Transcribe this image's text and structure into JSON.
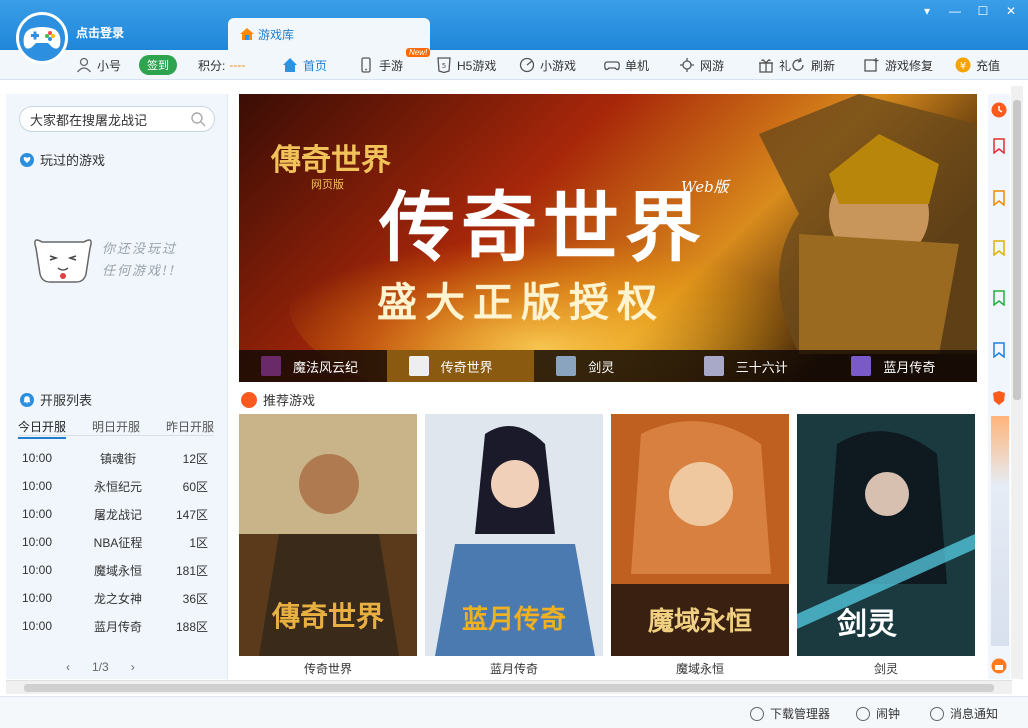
{
  "header": {
    "login_text": "点击登录",
    "tab_label": "游戏库",
    "window_controls": [
      "▾",
      "—",
      "☐",
      "✕"
    ]
  },
  "toolbar": {
    "nickname": "小号",
    "signin": "签到",
    "score_label": "积分:",
    "score_value": "----",
    "nav": [
      {
        "label": "首页",
        "icon": "home-icon"
      },
      {
        "label": "手游",
        "icon": "phone-icon",
        "badge": "New!"
      },
      {
        "label": "H5游戏",
        "icon": "h5-icon"
      },
      {
        "label": "小游戏",
        "icon": "mini-game-icon"
      },
      {
        "label": "单机",
        "icon": "gamepad-icon"
      },
      {
        "label": "网游",
        "icon": "network-icon"
      },
      {
        "label": "礼",
        "icon": "gift-icon"
      }
    ],
    "actions": [
      {
        "label": "刷新",
        "icon": "refresh-icon"
      },
      {
        "label": "游戏修复",
        "icon": "repair-icon"
      },
      {
        "label": "充值",
        "icon": "yen-icon"
      }
    ]
  },
  "sidebar": {
    "search_value": "大家都在搜屠龙战记",
    "played_title": "玩过的游戏",
    "empty_line1": "你还没玩过",
    "empty_line2": "任何游戏!!",
    "server_title": "开服列表",
    "server_tabs": [
      "今日开服",
      "明日开服",
      "昨日开服"
    ],
    "servers": [
      {
        "time": "10:00",
        "name": "镇魂街",
        "zone": "12区"
      },
      {
        "time": "10:00",
        "name": "永恒纪元",
        "zone": "60区"
      },
      {
        "time": "10:00",
        "name": "屠龙战记",
        "zone": "147区"
      },
      {
        "time": "10:00",
        "name": "NBA征程",
        "zone": "1区"
      },
      {
        "time": "10:00",
        "name": "魔域永恒",
        "zone": "181区"
      },
      {
        "time": "10:00",
        "name": "龙之女神",
        "zone": "36区"
      },
      {
        "time": "10:00",
        "name": "蓝月传奇",
        "zone": "188区"
      }
    ],
    "pager": {
      "prev": "‹",
      "page": "1/3",
      "next": "›"
    }
  },
  "banner": {
    "title": "传奇世界",
    "tag": "Web版",
    "subtitle": "盛大正版授权",
    "logo_line1": "傳奇世界",
    "logo_line2": "网页版",
    "thumbs": [
      "魔法风云纪",
      "传奇世界",
      "剑灵",
      "三十六计",
      "蓝月传奇"
    ],
    "active_thumb": 1
  },
  "recommended": {
    "title": "推荐游戏",
    "cards": [
      {
        "name": "传奇世界",
        "art": "傳奇世界"
      },
      {
        "name": "蓝月传奇",
        "art": "蓝月传奇"
      },
      {
        "name": "魔域永恒",
        "art": "魔域永恒"
      },
      {
        "name": "剑灵",
        "art": "剑灵"
      }
    ]
  },
  "statusbar": {
    "download": "下载管理器",
    "alarm": "闹钟",
    "message": "消息通知"
  },
  "colors": {
    "accent": "#1e7fd0",
    "header": "#2a93e4",
    "signin": "#2ea44f",
    "banner_active": "#8a5a10"
  }
}
